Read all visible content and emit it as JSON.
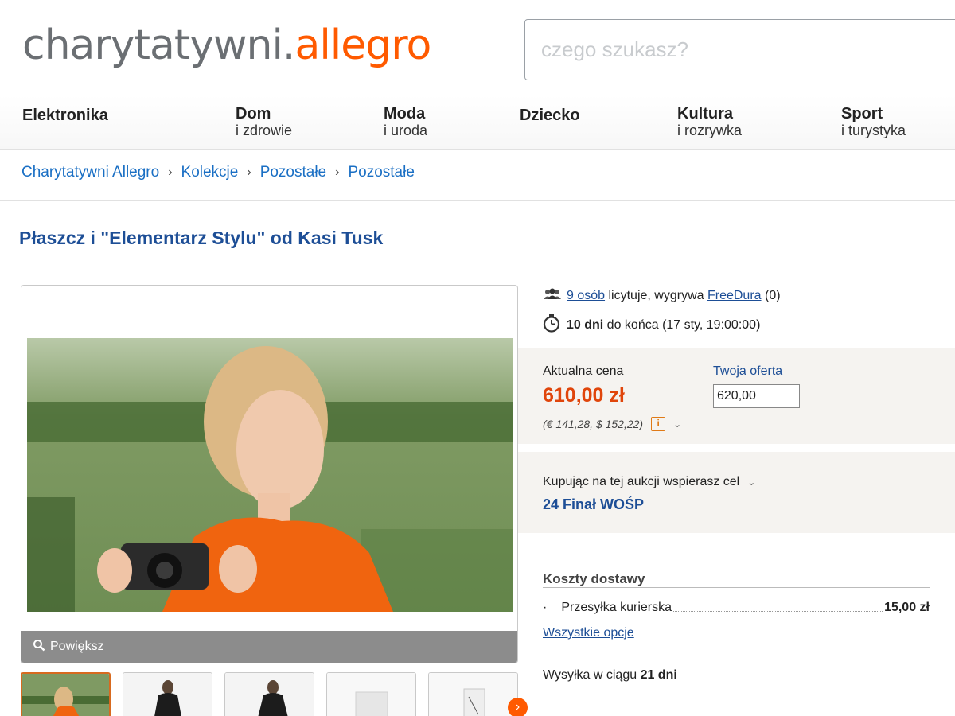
{
  "header": {
    "logo_part1": "charytatywni.",
    "logo_part2": "allegro",
    "search_placeholder": "czego szukasz?"
  },
  "categories": [
    {
      "line1": "Elektronika",
      "line2": ""
    },
    {
      "line1": "Dom",
      "line2": "i zdrowie"
    },
    {
      "line1": "Moda",
      "line2": "i uroda"
    },
    {
      "line1": "Dziecko",
      "line2": ""
    },
    {
      "line1": "Kultura",
      "line2": "i rozrywka"
    },
    {
      "line1": "Sport",
      "line2": "i turystyka"
    }
  ],
  "breadcrumb": [
    "Charytatywni Allegro",
    "Kolekcje",
    "Pozostałe",
    "Pozostałe"
  ],
  "breadcrumb_separator": "›",
  "product": {
    "title": "Płaszcz i \"Elementarz Stylu\" od Kasi Tusk"
  },
  "gallery": {
    "zoom_label": "Powiększ",
    "thumbnail_count": 5,
    "active_thumbnail": 1
  },
  "auction": {
    "bidders_count": "9 osób",
    "bidders_text": " licytuje, wygrywa ",
    "winner": "FreeDura",
    "winner_rating": " (0)",
    "days_left": "10 dni",
    "days_text": " do końca (17 sty, 19:00:00)"
  },
  "price": {
    "label": "Aktualna cena",
    "value": "610,00 zł",
    "converted": "(€ 141,28, $ 152,22)",
    "offer_label": "Twoja oferta",
    "offer_value": "620,00"
  },
  "cause": {
    "label": "Kupując na tej aukcji wspierasz cel",
    "name": "24 Finał WOŚP"
  },
  "shipping": {
    "title": "Koszty dostawy",
    "method": "Przesyłka kurierska",
    "cost": "15,00 zł",
    "all_options": "Wszystkie opcje",
    "dispatch_prefix": "Wysyłka w ciągu ",
    "dispatch_days": "21 dni"
  },
  "colors": {
    "brand_orange": "#ff5a00",
    "link_blue": "#1a6fc4",
    "title_blue": "#1d4e96",
    "price_red": "#e0450b"
  }
}
